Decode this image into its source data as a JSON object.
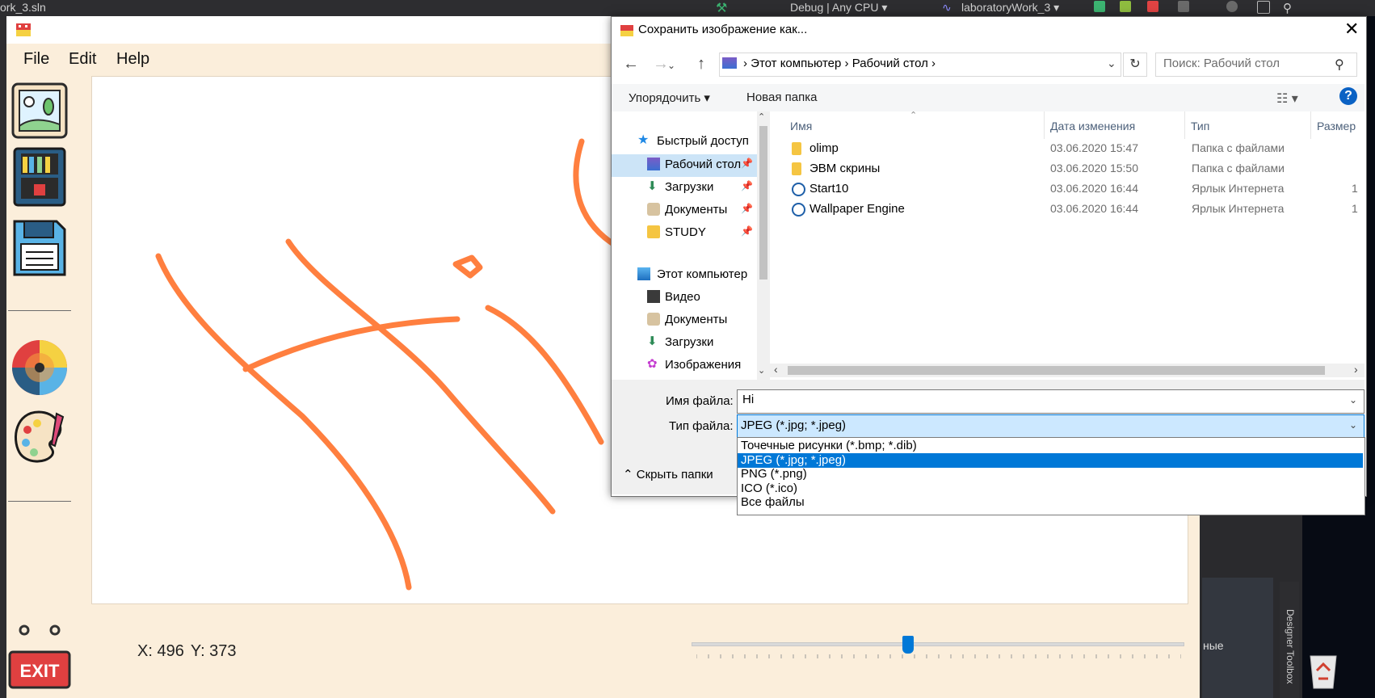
{
  "vs": {
    "solution": "ork_3.sln",
    "config": "Debug | Any CPU",
    "project": "laboratoryWork_3",
    "side_text": "ные",
    "toolbox_label": "Designer Toolbox"
  },
  "app": {
    "menu": [
      "File",
      "Edit",
      "Help"
    ],
    "coords_x": "X: 496",
    "coords_y": "Y: 373",
    "exit_label": "EXIT",
    "brush_color": "#ff7f3f",
    "slider_value_fraction": 0.44,
    "tools": [
      "picture-icon",
      "bookshelf-icon",
      "floppy-disk-icon",
      "color-wheel-icon",
      "palette-icon"
    ]
  },
  "dialog": {
    "title": "Сохранить изображение как...",
    "breadcrumb": [
      "Этот компьютер",
      "Рабочий стол"
    ],
    "search_placeholder": "Поиск: Рабочий стол",
    "toolbar": {
      "organize": "Упорядочить",
      "new_folder": "Новая папка"
    },
    "nav": {
      "quick_access": "Быстрый доступ",
      "quick_items": [
        {
          "label": "Рабочий стол",
          "icon": "desktop-icon"
        },
        {
          "label": "Загрузки",
          "icon": "download-icon"
        },
        {
          "label": "Документы",
          "icon": "documents-icon"
        },
        {
          "label": "STUDY",
          "icon": "folder-icon"
        }
      ],
      "this_pc": "Этот компьютер",
      "pc_items": [
        {
          "label": "Видео",
          "icon": "video-icon"
        },
        {
          "label": "Документы",
          "icon": "documents-icon"
        },
        {
          "label": "Загрузки",
          "icon": "download-icon"
        },
        {
          "label": "Изображения",
          "icon": "pictures-icon"
        }
      ]
    },
    "columns": [
      "Имя",
      "Дата изменения",
      "Тип",
      "Размер"
    ],
    "files": [
      {
        "name": "olimp",
        "date": "03.06.2020 15:47",
        "type": "Папка с файлами",
        "size": "",
        "icon": "folder-icon"
      },
      {
        "name": "ЭВМ скрины",
        "date": "03.06.2020 15:50",
        "type": "Папка с файлами",
        "size": "",
        "icon": "folder-icon"
      },
      {
        "name": "Start10",
        "date": "03.06.2020 16:44",
        "type": "Ярлык Интернета",
        "size": "1",
        "icon": "internet-shortcut-icon"
      },
      {
        "name": "Wallpaper Engine",
        "date": "03.06.2020 16:44",
        "type": "Ярлык Интернета",
        "size": "1",
        "icon": "internet-shortcut-icon"
      }
    ],
    "file_name_label": "Имя файла:",
    "file_name_value": "Hi",
    "file_type_label": "Тип файла:",
    "file_type_value": "JPEG (*.jpg; *.jpeg)",
    "hide_folders": "Скрыть папки",
    "type_options": [
      "Точечные рисунки (*.bmp; *.dib)",
      "JPEG (*.jpg; *.jpeg)",
      "PNG (*.png)",
      "ICO (*.ico)",
      "Все файлы"
    ],
    "selected_option_index": 1
  }
}
